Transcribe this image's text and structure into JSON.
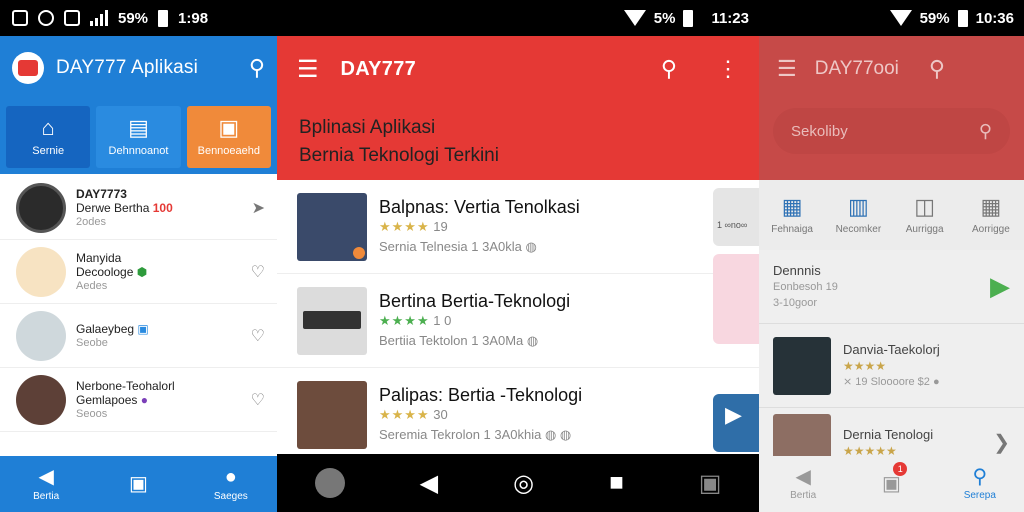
{
  "screen1": {
    "status": {
      "battery": "59%",
      "time": "1:98"
    },
    "appbar": {
      "title": "DAY777  Aplikasi",
      "search_icon": "search-icon"
    },
    "categories": [
      {
        "label": "Sernie",
        "icon": "home-icon"
      },
      {
        "label": "Dehnnoanot",
        "icon": "document-icon"
      },
      {
        "label": "Bennoeaehd",
        "icon": "bag-icon"
      }
    ],
    "list": [
      {
        "title": "DAY7773",
        "sub1": "Derwe Bertha",
        "badge": "100",
        "sub2": "2odes"
      },
      {
        "title": "Manyida",
        "sub1": "Decoologe",
        "badge": "",
        "sub2": "Aedes"
      },
      {
        "title": "Galaeybeg",
        "sub1": "",
        "badge": "",
        "sub2": "Seobe"
      },
      {
        "title": "Nerbone-Teohalorl",
        "sub1": "Gemlapoes",
        "badge": "",
        "sub2": "Seoos"
      }
    ],
    "bottom_nav": [
      {
        "label": "Bertia",
        "icon": "play-icon"
      },
      {
        "label": "",
        "icon": "bag-icon"
      },
      {
        "label": "Saeges",
        "icon": "person-icon"
      }
    ]
  },
  "screen2": {
    "status": {
      "battery": "5%",
      "time": "11:23"
    },
    "appbar": {
      "title": "DAY777"
    },
    "banner": {
      "line1": "Bplinasi Aplikasi",
      "line2": "Bernia Teknologi Terkini"
    },
    "list": [
      {
        "name": "Balpnas: Vertia Tenolkasi",
        "stars": "★★★★",
        "rating": "19",
        "meta": "Sernia  Telnesia  1 3A0kla  ◍"
      },
      {
        "name": "Bertina Bertia-Teknologi",
        "stars": "★★★★",
        "rating": "1 0",
        "meta": "Bertiia  Tektolon  1 3A0Ma  ◍"
      },
      {
        "name": "Palipas: Bertia -Teknologi",
        "stars": "★★★★",
        "rating": "30",
        "meta": "Seremia  Tekrolon  1 3A0khia  ◍ ◍"
      }
    ],
    "side_labels": [
      "1 ∞no∞"
    ]
  },
  "screen3": {
    "status": {
      "battery": "59%",
      "time": "10:36"
    },
    "appbar": {
      "title": "DAY77ooi"
    },
    "search": {
      "placeholder": "Sekoliby"
    },
    "categories": [
      {
        "label": "Fehnaiga",
        "icon": "calendar-icon"
      },
      {
        "label": "Necomker",
        "icon": "columns-icon"
      },
      {
        "label": "Aurrigga",
        "icon": "board-icon"
      },
      {
        "label": "Aorrigge",
        "icon": "grid-icon"
      }
    ],
    "list": [
      {
        "title": "Dennnis",
        "sub1": "Eonbesoh 19",
        "sub2": "3-10goor"
      },
      {
        "title": "Danvia-Taekolorj",
        "stars": "★★★★",
        "sub2": "⨯ 19 Sloooore $2 ●"
      },
      {
        "title": "Dernia  Tenologi",
        "stars": "★★★★★"
      }
    ],
    "bottom_nav": [
      {
        "label": "Bertia",
        "icon": "play-icon"
      },
      {
        "label": "",
        "icon": "bag-icon",
        "notification": "1"
      },
      {
        "label": "Serepa",
        "icon": "search-icon"
      }
    ]
  },
  "colors": {
    "blue": "#1f7fd6",
    "red": "#e53935",
    "muted_red": "#c64a48",
    "orange": "#f08a3a"
  }
}
